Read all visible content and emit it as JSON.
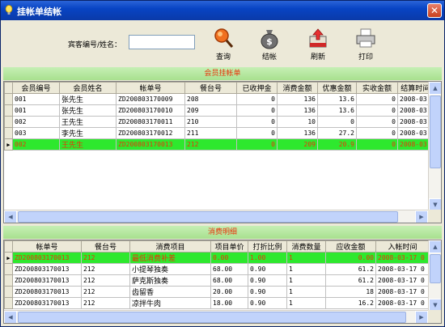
{
  "window": {
    "title": "挂帐单结帐",
    "close": "✕"
  },
  "toolbar": {
    "search_label": "宾客编号/姓名：",
    "search_value": "",
    "query": "查询",
    "checkout": "结帐",
    "refresh": "刷新",
    "print": "打印"
  },
  "section1": {
    "title": "会员挂帐单"
  },
  "bills": {
    "headers": [
      "会员编号",
      "会员姓名",
      "帐单号",
      "餐台号",
      "已收押金",
      "消费金额",
      "优惠金额",
      "实收金额",
      "结算时间"
    ],
    "rows": [
      [
        "001",
        "张先生",
        "ZD200803170009",
        "208",
        "0",
        "136",
        "13.6",
        "0",
        "2008-03-"
      ],
      [
        "001",
        "张先生",
        "ZD200803170010",
        "209",
        "0",
        "136",
        "13.6",
        "0",
        "2008-03-"
      ],
      [
        "002",
        "王先生",
        "ZD200803170011",
        "210",
        "0",
        "10",
        "0",
        "0",
        "2008-03-"
      ],
      [
        "003",
        "李先生",
        "ZD200803170012",
        "211",
        "0",
        "136",
        "27.2",
        "0",
        "2008-03-"
      ],
      [
        "002",
        "王先生",
        "ZD200803170013",
        "212",
        "0",
        "209",
        "20.9",
        "0",
        "2008-03-"
      ]
    ],
    "selected_index": 4
  },
  "section2": {
    "title": "消费明细"
  },
  "details": {
    "headers": [
      "帐单号",
      "餐台号",
      "消费项目",
      "项目单价",
      "打折比例",
      "消费数量",
      "应收金额",
      "入帐时间"
    ],
    "rows": [
      [
        "ZD200803170013",
        "212",
        "最低消费补差",
        "0.00",
        "1.00",
        "1",
        "0.00",
        "2008-03-17 0"
      ],
      [
        "ZD200803170013",
        "212",
        "小提琴独奏",
        "68.00",
        "0.90",
        "1",
        "61.2",
        "2008-03-17 0"
      ],
      [
        "ZD200803170013",
        "212",
        "萨克斯独奏",
        "68.00",
        "0.90",
        "1",
        "61.2",
        "2008-03-17 0"
      ],
      [
        "ZD200803170013",
        "212",
        "齿留香",
        "20.00",
        "0.90",
        "1",
        "18",
        "2008-03-17 0"
      ],
      [
        "ZD200803170013",
        "212",
        "凉拌牛肉",
        "18.00",
        "0.90",
        "1",
        "16.2",
        "2008-03-17 0"
      ]
    ],
    "selected_index": 0
  }
}
